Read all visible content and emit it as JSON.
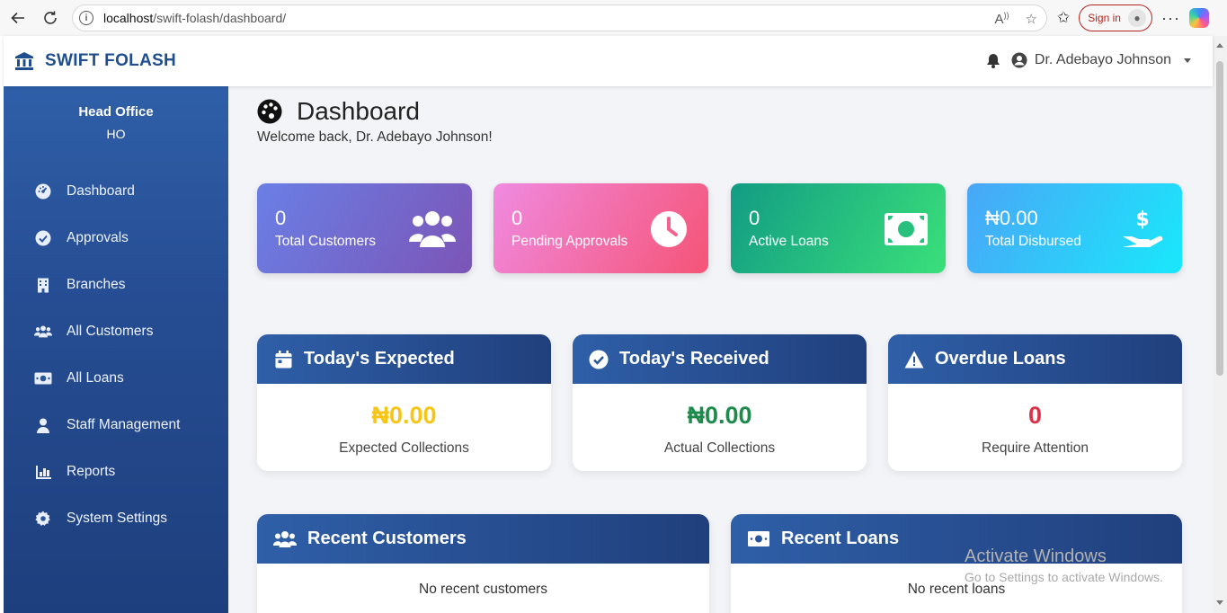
{
  "browser": {
    "url_host": "localhost",
    "url_path": "/swift-folash/dashboard/",
    "sign_in_label": "Sign in"
  },
  "header": {
    "brand": "SWIFT FOLASH",
    "user_name": "Dr. Adebayo Johnson"
  },
  "sidebar": {
    "office_name": "Head Office",
    "office_code": "HO",
    "items": [
      {
        "label": "Dashboard",
        "icon": "tachometer-icon"
      },
      {
        "label": "Approvals",
        "icon": "check-circle-icon"
      },
      {
        "label": "Branches",
        "icon": "building-icon"
      },
      {
        "label": "All Customers",
        "icon": "users-icon"
      },
      {
        "label": "All Loans",
        "icon": "money-bill-icon"
      },
      {
        "label": "Staff Management",
        "icon": "user-icon"
      },
      {
        "label": "Reports",
        "icon": "chart-bar-icon"
      },
      {
        "label": "System Settings",
        "icon": "gear-icon"
      }
    ]
  },
  "main": {
    "title": "Dashboard",
    "welcome": "Welcome back, Dr. Adebayo Johnson!",
    "stats": [
      {
        "value": "0",
        "label": "Total Customers",
        "icon": "users-icon"
      },
      {
        "value": "0",
        "label": "Pending Approvals",
        "icon": "clock-icon"
      },
      {
        "value": "0",
        "label": "Active Loans",
        "icon": "money-bill-icon"
      },
      {
        "value": "₦0.00",
        "label": "Total Disbursed",
        "icon": "hand-dollar-icon"
      }
    ],
    "collections": [
      {
        "title": "Today's Expected",
        "value": "₦0.00",
        "label": "Expected Collections",
        "color": "#f5c518",
        "icon": "calendar-icon"
      },
      {
        "title": "Today's Received",
        "value": "₦0.00",
        "label": "Actual Collections",
        "color": "#1e8a4c",
        "icon": "check-circle-icon"
      },
      {
        "title": "Overdue Loans",
        "value": "0",
        "label": "Require Attention",
        "color": "#d9334a",
        "icon": "warning-icon"
      }
    ],
    "recent_customers": {
      "title": "Recent Customers",
      "empty": "No recent customers"
    },
    "recent_loans": {
      "title": "Recent Loans",
      "empty": "No recent loans"
    }
  },
  "watermark": {
    "line1": "Activate Windows",
    "line2": "Go to Settings to activate Windows."
  },
  "colors": {
    "brand": "#1f4e8f",
    "sidebar": "#2a569c"
  }
}
